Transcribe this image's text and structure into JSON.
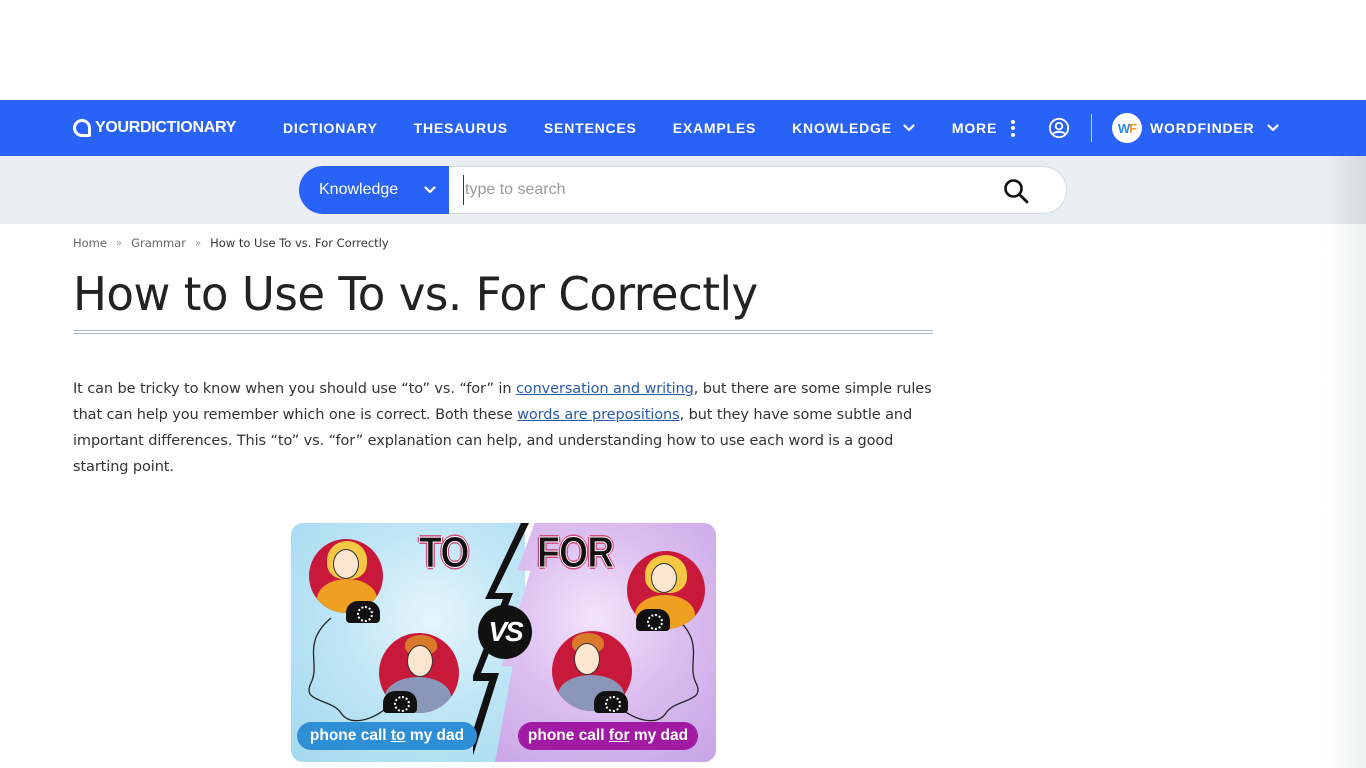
{
  "nav": {
    "logo_text": "YOURDICTIONARY",
    "links": [
      {
        "label": "DICTIONARY"
      },
      {
        "label": "THESAURUS"
      },
      {
        "label": "SENTENCES"
      },
      {
        "label": "EXAMPLES"
      },
      {
        "label": "KNOWLEDGE",
        "icon": "chevron-down-icon"
      },
      {
        "label": "MORE",
        "icon": "vertical-dots-icon"
      }
    ],
    "user_icon": "user-circle-icon",
    "wordfinder_badge_w": "W",
    "wordfinder_badge_f": "F",
    "wordfinder_label": "WORDFINDER",
    "brand_color": "#2962f7"
  },
  "search": {
    "category": "Knowledge",
    "placeholder": "type to search",
    "value": "",
    "button_icon": "search-icon"
  },
  "breadcrumb": [
    {
      "label": "Home"
    },
    {
      "label": "Grammar"
    },
    {
      "label": "How to Use To vs. For Correctly"
    }
  ],
  "breadcrumb_separator": "»",
  "article": {
    "title": "How to Use To vs. For Correctly",
    "intro": {
      "part1": "It can be tricky to know when you should use “to” vs. “for” in ",
      "link1": "conversation and writing",
      "part2": ", but there are some simple rules that can help you remember which one is correct. Both these ",
      "link2": "words are prepositions",
      "part3": ", but they have some subtle and important differences. This “to” vs. “for” explanation can help, and understanding how to use each word is a good starting point."
    },
    "figure": {
      "word_left": "TO",
      "word_right": "FOR",
      "vs": "VS",
      "label_left_pre": "phone call ",
      "label_left_key": "to",
      "label_left_post": " my dad",
      "label_right_pre": "phone call ",
      "label_right_key": "for",
      "label_right_post": " my dad"
    }
  }
}
